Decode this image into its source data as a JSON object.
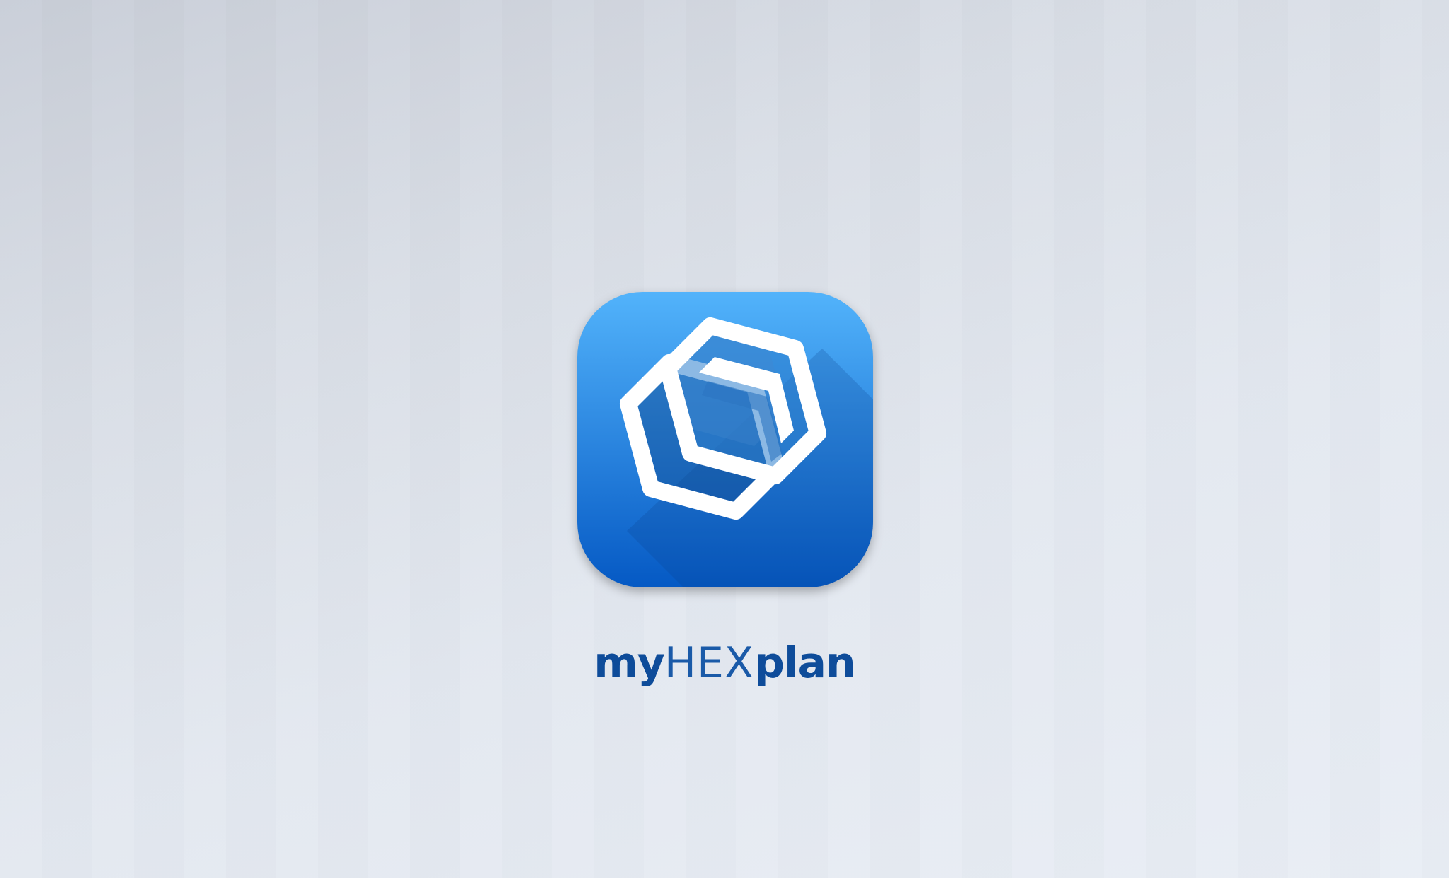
{
  "app": {
    "name_parts": {
      "prefix": "my",
      "middle": "HEX",
      "suffix": "plan"
    }
  },
  "icon": {
    "name": "hexagon-logo-icon",
    "gradient_top": "#52b3fb",
    "gradient_bottom": "#0559c4",
    "mark_color": "#ffffff"
  },
  "colors": {
    "wordmark": "#0e4c9a",
    "background_top": "#c9ced8",
    "background_bottom": "#e9eef5"
  }
}
